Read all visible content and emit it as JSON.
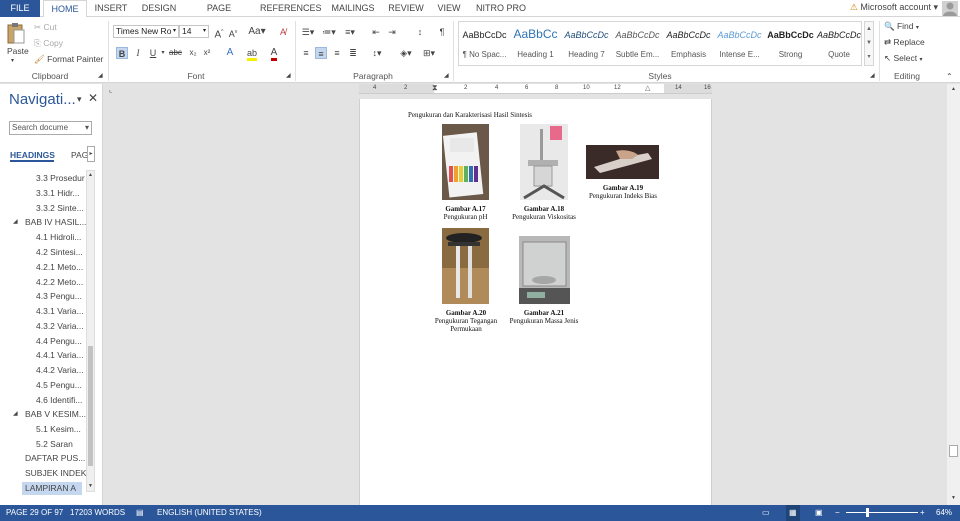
{
  "tabs": {
    "file": "FILE",
    "items": [
      "HOME",
      "INSERT",
      "DESIGN",
      "PAGE LAYOUT",
      "REFERENCES",
      "MAILINGS",
      "REVIEW",
      "VIEW",
      "NITRO PRO"
    ],
    "account": "Microsoft account"
  },
  "clipboard": {
    "paste": "Paste",
    "cut": "Cut",
    "copy": "Copy",
    "format_painter": "Format Painter",
    "label": "Clipboard"
  },
  "font": {
    "family": "Times New Ro",
    "size": "14",
    "label": "Font"
  },
  "paragraph": {
    "label": "Paragraph"
  },
  "styles": {
    "items": [
      {
        "sample": "AaBbCcDc",
        "name": "¶ No Spac..."
      },
      {
        "sample": "AaBbCc",
        "name": "Heading 1"
      },
      {
        "sample": "AaBbCcDc",
        "name": "Heading 7"
      },
      {
        "sample": "AaBbCcDc",
        "name": "Subtle Em..."
      },
      {
        "sample": "AaBbCcDc",
        "name": "Emphasis"
      },
      {
        "sample": "AaBbCcDc",
        "name": "Intense E..."
      },
      {
        "sample": "AaBbCcDc",
        "name": "Strong"
      },
      {
        "sample": "AaBbCcDc",
        "name": "Quote"
      }
    ],
    "label": "Styles"
  },
  "editing": {
    "find": "Find",
    "replace": "Replace",
    "select": "Select",
    "label": "Editing"
  },
  "nav": {
    "title": "Navigati...",
    "search_placeholder": "Search docume",
    "tab_headings": "HEADINGS",
    "tab_pages": "PAG",
    "items": [
      "3.3 Prosedur",
      "3.3.1 Hidr...",
      "3.3.2 Sinte...",
      "BAB IV HASIL...",
      "4.1 Hidroli...",
      "4.2 Sintesi...",
      "4.2.1 Meto...",
      "4.2.2 Meto...",
      "4.3 Pengu...",
      "4.3.1 Varia...",
      "4.3.2 Varia...",
      "4.4 Pengu...",
      "4.4.1 Varia...",
      "4.4.2 Varia...",
      "4.5 Pengu...",
      "4.6 Identifi...",
      "BAB V KESIM...",
      "5.1 Kesim...",
      "5.2 Saran",
      "DAFTAR PUS...",
      "SUBJEK INDEKS",
      "LAMPIRAN A"
    ]
  },
  "ruler": {
    "ticks": [
      "4",
      "2",
      "2",
      "4",
      "6",
      "8",
      "10",
      "12",
      "14",
      "16"
    ]
  },
  "document": {
    "heading": "Pengukuran dan Karakterisasi Hasil Sintesis",
    "figures": [
      {
        "label": "Gambar A.17",
        "caption": "Pengukuran pH"
      },
      {
        "label": "Gambar A.18",
        "caption": "Pengukuran Viskositas"
      },
      {
        "label": "Gambar A.19",
        "caption": "Pengukuran Indeks Bias"
      },
      {
        "label": "Gambar A.20",
        "caption": "Pengukuran Tegangan Permukaan"
      },
      {
        "label": "Gambar A.21",
        "caption": "Pengukuran Massa Jenis"
      }
    ]
  },
  "status": {
    "page": "PAGE 29 OF 97",
    "words": "17203 WORDS",
    "language": "ENGLISH (UNITED STATES)",
    "zoom": "64%"
  },
  "colors": {
    "accent": "#2b579a",
    "ribbon_bg": "#ffffff",
    "canvas_bg": "#e3e3e3"
  }
}
